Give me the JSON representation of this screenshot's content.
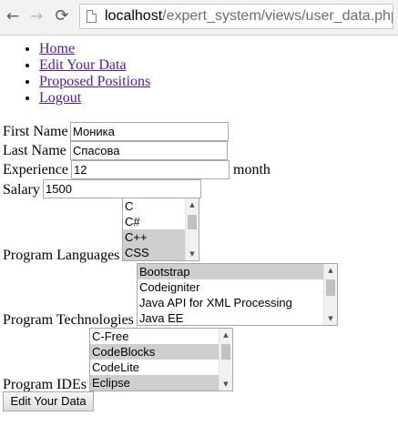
{
  "browser": {
    "url_host": "localhost",
    "url_path": "/expert_system/views/user_data.php",
    "back_icon": "←",
    "forward_icon": "→",
    "reload_icon": "⟳"
  },
  "nav": {
    "items": [
      "Home",
      "Edit Your Data",
      "Proposed Positions",
      "Logout"
    ]
  },
  "form": {
    "first_name": {
      "label": "First Name",
      "value": "Моника"
    },
    "last_name": {
      "label": "Last Name",
      "value": "Спасова"
    },
    "experience": {
      "label": "Experience",
      "value": "12",
      "suffix": "month"
    },
    "salary": {
      "label": "Salary",
      "value": "1500"
    },
    "languages": {
      "label": "Program Languages",
      "options": [
        {
          "text": "C",
          "selected": false
        },
        {
          "text": "C#",
          "selected": false
        },
        {
          "text": "C++",
          "selected": true
        },
        {
          "text": "CSS",
          "selected": true
        }
      ]
    },
    "technologies": {
      "label": "Program Technologies",
      "options": [
        {
          "text": "Bootstrap",
          "selected": true
        },
        {
          "text": "Codeigniter",
          "selected": false
        },
        {
          "text": "Java API for XML Processing",
          "selected": false
        },
        {
          "text": "Java EE",
          "selected": false
        }
      ]
    },
    "ides": {
      "label": "Program IDEs",
      "options": [
        {
          "text": "C-Free",
          "selected": false
        },
        {
          "text": "CodeBlocks",
          "selected": true
        },
        {
          "text": "CodeLite",
          "selected": false
        },
        {
          "text": "Eclipse",
          "selected": true
        }
      ]
    },
    "submit_label": "Edit Your Data"
  },
  "colors": {
    "link_visited": "#551a8b",
    "selected_option": "#cecece"
  }
}
